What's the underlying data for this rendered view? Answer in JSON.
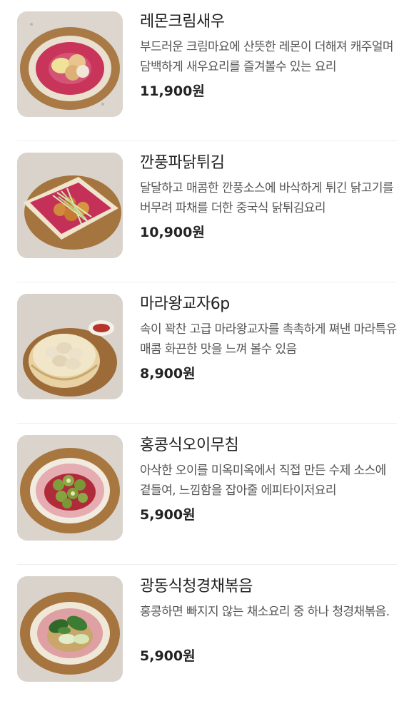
{
  "menu": {
    "items": [
      {
        "name": "레몬크림새우",
        "description": "부드러운 크림마요에 산뜻한 레몬이 더해져 캐주얼며 담백하게 새우요리를 즐겨볼수 있는 요리",
        "price": "11,900원",
        "image": "lemon-cream-shrimp-photo"
      },
      {
        "name": "깐풍파닭튀김",
        "description": "달달하고 매콤한 깐풍소스에 바삭하게 튀긴 닭고기를 버무려 파채를 더한 중국식 닭튀김요리",
        "price": "10,900원",
        "image": "kkanpung-fried-chicken-photo"
      },
      {
        "name": "마라왕교자6p",
        "description": "속이 꽉찬 고급 마라왕교자를 촉촉하게 쪄낸 마라특유 매콤 화끈한 맛을 느껴 볼수 있음",
        "price": "8,900원",
        "image": "mala-dumpling-photo"
      },
      {
        "name": "홍콩식오이무침",
        "description": "아삭한 오이를 미옥미옥에서 직접 만든 수제 소스에 곁들여, 느낌함을 잡아줄 에피타이저요리",
        "price": "5,900원",
        "image": "cucumber-salad-photo"
      },
      {
        "name": "광동식청경채볶음",
        "description": "홍콩하면 빠지지 않는 채소요리 중 하나 청경채볶음.",
        "price": "5,900원",
        "image": "bok-choy-stir-fry-photo"
      }
    ]
  }
}
